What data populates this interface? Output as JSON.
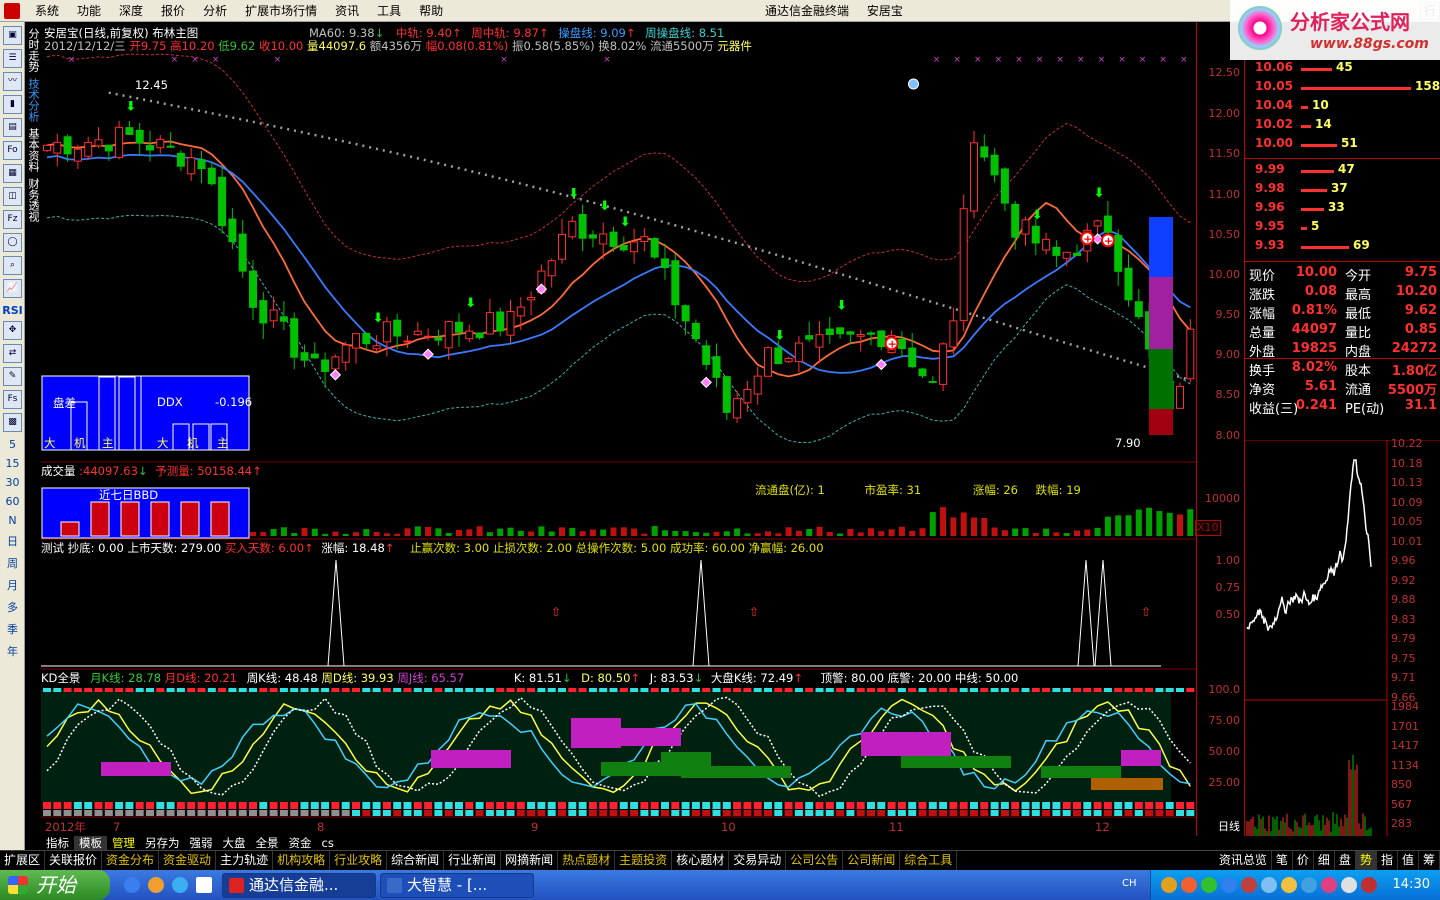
{
  "menu": [
    "系统",
    "功能",
    "深度",
    "报价",
    "分析",
    "扩展市场行情",
    "资讯",
    "工具",
    "帮助"
  ],
  "window_title": [
    "通达信金融终端",
    "安居宝"
  ],
  "window_btn_label": "行",
  "logo": {
    "name": "分析家公式网",
    "url": "www.88gs.com"
  },
  "left_tabs": [
    "分时走势",
    "技术分析",
    "基本资料",
    "财务透视"
  ],
  "left_tools": [
    "Fo",
    "RSI",
    "Fs",
    "5",
    "15",
    "30",
    "60",
    "N",
    "日",
    "周",
    "月",
    "多",
    "季",
    "年"
  ],
  "main_title": {
    "stock": "安居宝(日线,前复权)",
    "indicator": "布林主图",
    "ma60": "MA60: 9.38",
    "mid": "中轨: 9.40",
    "week_mid": "周中轨: 9.87",
    "cp": "操盘线: 9.09",
    "week_cp": "周操盘线: 8.51"
  },
  "info_line": {
    "date": "2012/12/12/三",
    "open": "开9.75",
    "high": "高10.20",
    "low": "低9.62",
    "close": "收10.00",
    "vol": "量44097.6",
    "amount": "额4356万",
    "pct": "幅0.08(0.81%)",
    "amp": "振0.58(5.85%)",
    "turnover": "换8.02%",
    "float": "流通5500万",
    "sector": "元器件"
  },
  "price_labels": {
    "high": "12.45",
    "low": "7.90"
  },
  "ddx": {
    "label": "DDX",
    "value": "-0.196",
    "title": "盘差",
    "cats": [
      "大",
      "机",
      "主"
    ]
  },
  "volume_panel": {
    "title": "成交量",
    "value": ":44097.63",
    "forecast": "予测量: 50158.44",
    "ddx_label": "近七日BBD",
    "float_cap": "流通盘(亿):",
    "float_cap_v": "1",
    "pe": "市盈率:",
    "pe_v": "31",
    "up": "涨幅:",
    "up_v": "26",
    "down": "跌幅:",
    "down_v": "19",
    "x10": "X10"
  },
  "test_panel": {
    "title": "测试",
    "bottom": "抄底: 0.00",
    "days": "上市天数: 279.00",
    "buy_days": "买入天数: 6.00",
    "up": "涨幅: 18.48",
    "tp": "止赢次数: 3.00",
    "sl": "止损次数: 2.00",
    "total": "总操作次数: 5.00",
    "rate": "成功率: 60.00",
    "net": "净赢幅: 26.00"
  },
  "kd_panel": {
    "title": "KD全景",
    "mk": "月K线: 28.78",
    "md": "月D线: 20.21",
    "wk": "周K线: 48.48",
    "wd": "周D线: 39.93",
    "wj": "周J线: 65.57",
    "k": "K: 81.51",
    "d": "D: 80.50",
    "j": "J: 83.53",
    "mkt": "大盘K线: 72.49",
    "top": "顶警: 80.00",
    "bot": "底警: 20.00",
    "mid": "中线: 50.00"
  },
  "x_axis": [
    "2012年",
    "7",
    "8",
    "9",
    "10",
    "11",
    "12"
  ],
  "axis_ticks": {
    "price": [
      "12.50",
      "12.00",
      "11.50",
      "11.00",
      "10.50",
      "10.00",
      "9.50",
      "9.00",
      "8.50",
      "8.00"
    ],
    "volume": [
      "10000"
    ],
    "test": [
      "1.00",
      "0.75",
      "0.50"
    ],
    "kd": [
      "100.0",
      "75.00",
      "50.00",
      "25.00"
    ],
    "period": "日线"
  },
  "order_book": {
    "asks": [
      {
        "price": "10.06",
        "vol": "45"
      },
      {
        "price": "10.05",
        "vol": "158"
      },
      {
        "price": "10.04",
        "vol": "10"
      },
      {
        "price": "10.02",
        "vol": "14"
      },
      {
        "price": "10.00",
        "vol": "51"
      }
    ],
    "bids": [
      {
        "price": "9.99",
        "vol": "47"
      },
      {
        "price": "9.98",
        "vol": "37"
      },
      {
        "price": "9.96",
        "vol": "33"
      },
      {
        "price": "9.95",
        "vol": "5"
      },
      {
        "price": "9.93",
        "vol": "69"
      }
    ]
  },
  "stats": [
    {
      "l": "现价",
      "v": "10.00",
      "l2": "今开",
      "v2": "9.75"
    },
    {
      "l": "涨跌",
      "v": "0.08",
      "l2": "最高",
      "v2": "10.20"
    },
    {
      "l": "涨幅",
      "v": "0.81%",
      "l2": "最低",
      "v2": "9.62"
    },
    {
      "l": "总量",
      "v": "44097",
      "l2": "量比",
      "v2": "0.85"
    },
    {
      "l": "外盘",
      "v": "19825",
      "l2": "内盘",
      "v2": "24272"
    },
    {
      "l": "换手",
      "v": "8.02%",
      "l2": "股本",
      "v2": "1.80亿"
    },
    {
      "l": "净资",
      "v": "5.61",
      "l2": "流通",
      "v2": "5500万"
    },
    {
      "l": "收益(三)",
      "v": "0.241",
      "l2": "PE(动)",
      "v2": "31.1"
    }
  ],
  "mini_axis": [
    "10.22",
    "10.18",
    "10.13",
    "10.09",
    "10.05",
    "10.01",
    "9.96",
    "9.92",
    "9.88",
    "9.83",
    "9.79",
    "9.75",
    "9.71",
    "9.66",
    "1984",
    "1701",
    "1417",
    "1134",
    "850",
    "567",
    "283"
  ],
  "bottom_tabs": [
    "指标",
    "模板",
    "管理",
    "另存为",
    "强弱",
    "大盘",
    "全景",
    "资金",
    "cs"
  ],
  "bottom_bar": [
    "扩展区",
    "关联报价",
    "资金分布",
    "资金驱动",
    "主力轨迹",
    "机构攻略",
    "行业攻略",
    "综合新闻",
    "行业新闻",
    "网摘新闻",
    "热点题材",
    "主题投资",
    "核心题材",
    "交易异动",
    "公司公告",
    "公司新闻",
    "综合工具"
  ],
  "bottom_right": [
    "资讯总览",
    "笔",
    "价",
    "细",
    "盘",
    "势",
    "指",
    "值",
    "筹"
  ],
  "taskbar": {
    "start": "开始",
    "tasks": [
      "通达信金融...",
      "大智慧 - [..."
    ],
    "ime": "CH",
    "clock": "14:30"
  },
  "colors": {
    "up": "#ff3030",
    "down": "#00c000",
    "bg": "#000000",
    "axis": "#b00000"
  }
}
